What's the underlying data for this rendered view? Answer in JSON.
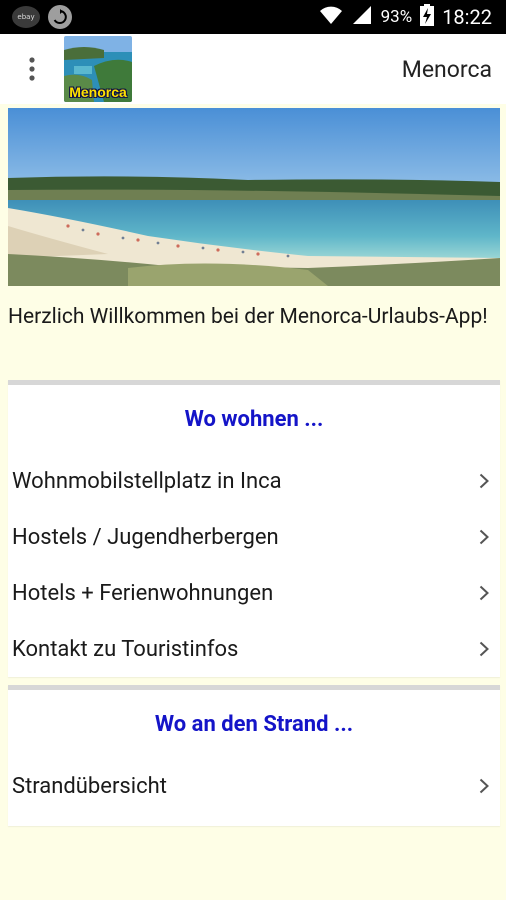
{
  "status_bar": {
    "battery_percent": "93%",
    "time": "18:22",
    "icons": [
      "ebay-notification-icon",
      "sync-icon",
      "wifi-icon",
      "signal-icon",
      "battery-charging-icon"
    ]
  },
  "app_bar": {
    "title": "Menorca",
    "logo_label": "Menorca",
    "menu_icon": "overflow-menu-icon"
  },
  "welcome_text": "Herzlich Willkommen bei der Menorca-Urlaubs-App!",
  "sections": [
    {
      "header": "Wo wohnen ...",
      "items": [
        {
          "label": "Wohnmobilstellplatz in Inca"
        },
        {
          "label": "Hostels / Jugendherbergen"
        },
        {
          "label": "Hotels + Ferienwohnungen"
        },
        {
          "label": "Kontakt zu Touristinfos"
        }
      ]
    },
    {
      "header": "Wo an den Strand ...",
      "items": [
        {
          "label": "Strandübersicht"
        }
      ]
    }
  ],
  "colors": {
    "background": "#fefee6",
    "section_header": "#1414c8",
    "divider": "#d7d7d7"
  }
}
